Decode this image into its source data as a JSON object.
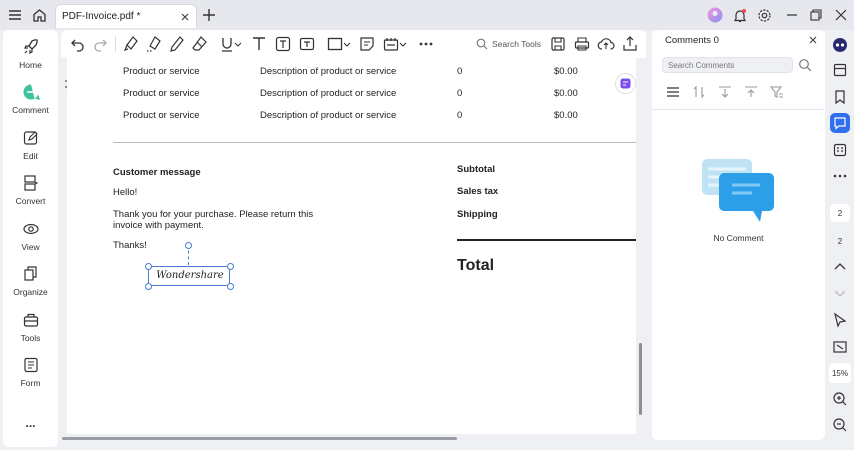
{
  "tab": {
    "title": "PDF-Invoice.pdf *"
  },
  "sidebar": {
    "items": [
      {
        "label": "Home",
        "icon": "rocket-icon"
      },
      {
        "label": "Comment",
        "icon": "comment-icon"
      },
      {
        "label": "Edit",
        "icon": "edit-icon"
      },
      {
        "label": "Convert",
        "icon": "convert-icon"
      },
      {
        "label": "View",
        "icon": "view-icon"
      },
      {
        "label": "Organize",
        "icon": "organize-icon"
      },
      {
        "label": "Tools",
        "icon": "tools-icon"
      },
      {
        "label": "Form",
        "icon": "form-icon"
      }
    ],
    "more": "..."
  },
  "toolbar": {
    "search_label": "Search Tools"
  },
  "document": {
    "rows": [
      {
        "item": "Product or service",
        "description": "Description of product or service",
        "qty": "0",
        "amount": "$0.00"
      },
      {
        "item": "Product or service",
        "description": "Description of product or service",
        "qty": "0",
        "amount": "$0.00"
      },
      {
        "item": "Product or service",
        "description": "Description of product or service",
        "qty": "0",
        "amount": "$0.00"
      }
    ],
    "customer_message_label": "Customer message",
    "hello": "Hello!",
    "thank_you_line1": "Thank you for your purchase. Please return this",
    "thank_you_line2": "invoice with payment.",
    "thanks": "Thanks!",
    "signature": "Wondershare",
    "subtotal_label": "Subtotal",
    "sales_tax_label": "Sales tax",
    "shipping_label": "Shipping",
    "total_label": "Total"
  },
  "comments_panel": {
    "title": "Comments 0",
    "search_placeholder": "Search Comments",
    "empty_label": "No Comment"
  },
  "right_rail": {
    "page_current": "2",
    "page_total": "2",
    "zoom": "15%"
  },
  "colors": {
    "accent": "#2f6fed",
    "comment_accent": "#3ec2a1",
    "background": "#eef0f4"
  }
}
